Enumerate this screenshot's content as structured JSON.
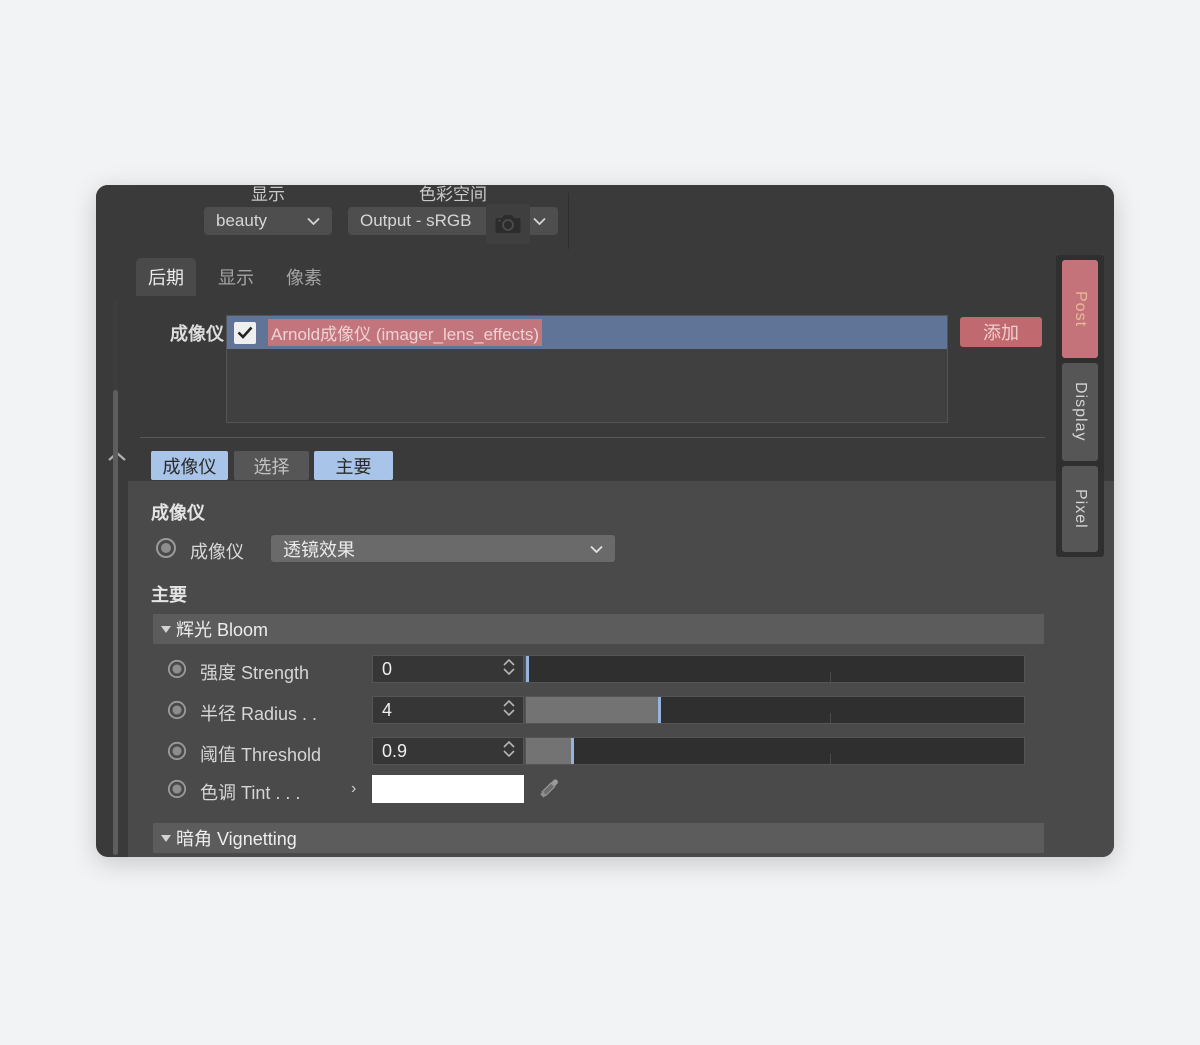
{
  "toolbar": {
    "display_caption": "显示",
    "display_value": "beauty",
    "colorspace_caption": "色彩空间",
    "colorspace_value": "Output - sRGB",
    "snapshot_icon": "camera-icon"
  },
  "panel_tabs": [
    {
      "label": "后期",
      "active": true
    },
    {
      "label": "显示",
      "active": false
    },
    {
      "label": "像素",
      "active": false
    }
  ],
  "imager_section": {
    "label": "成像仪",
    "checkbox_checked": true,
    "item_name": "Arnold成像仪 (imager_lens_effects)",
    "add_label": "添加"
  },
  "mini_tabs": [
    {
      "label": "成像仪",
      "state": "sel"
    },
    {
      "label": "选择",
      "state": "unsel"
    },
    {
      "label": "主要",
      "state": "sel"
    }
  ],
  "imager_group": {
    "title": "成像仪",
    "row_label": "成像仪",
    "value": "透镜效果"
  },
  "main_group": {
    "title": "主要",
    "bloom": {
      "header": "辉光 Bloom",
      "params": [
        {
          "label": "强度 Strength",
          "value": "0",
          "fill_pct": 0,
          "handle_pct": 0,
          "tick_pct": 61
        },
        {
          "label": "半径 Radius . .",
          "value": "4",
          "fill_pct": 26.5,
          "handle_pct": 26.5,
          "tick_pct": 61
        },
        {
          "label": "阈值 Threshold",
          "value": "0.9",
          "fill_pct": 9,
          "handle_pct": 9,
          "tick_pct": 61
        }
      ],
      "tint": {
        "label": "色调 Tint . . .",
        "expand": "›",
        "swatch_color": "#ffffff",
        "picker_icon": "eyedropper-icon"
      }
    },
    "vignetting": {
      "header": "暗角 Vignetting"
    }
  },
  "side_tabs": [
    {
      "label": "Post",
      "active": true
    },
    {
      "label": "Display",
      "active": false
    },
    {
      "label": "Pixel",
      "active": false
    }
  ],
  "colors": {
    "accent_rose": "#c4737a",
    "selection_blue": "#5f7496",
    "tab_blue": "#a8c4e8",
    "handle_blue": "#95b3dd"
  }
}
